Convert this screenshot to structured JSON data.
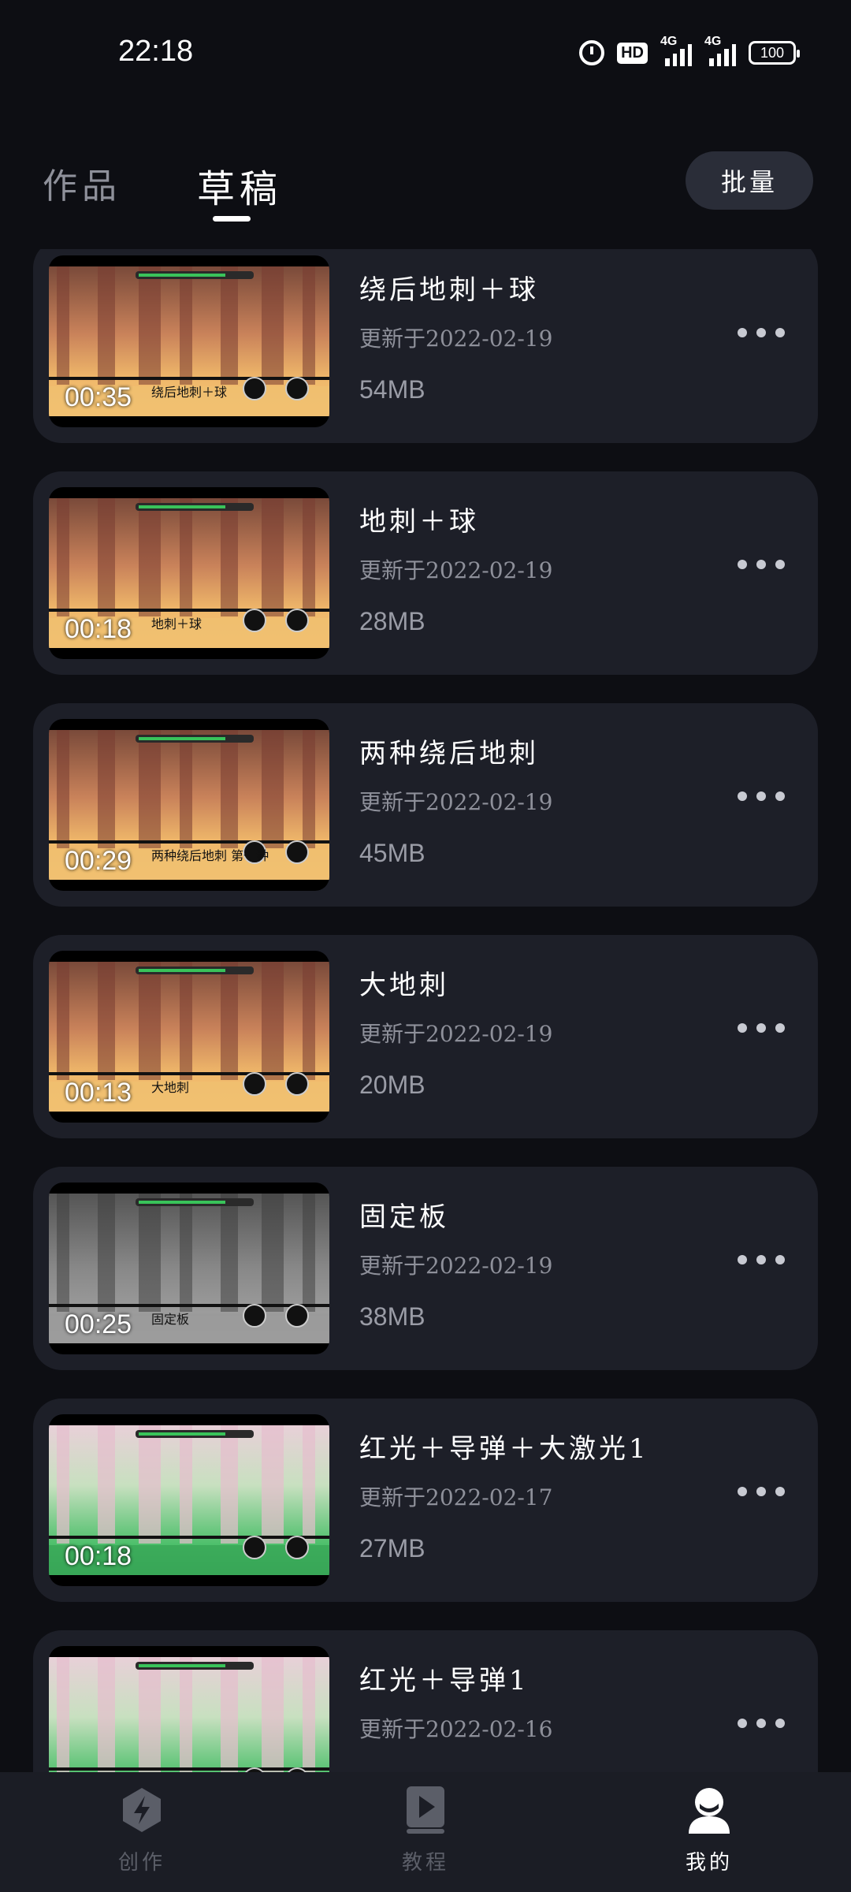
{
  "status_bar": {
    "time": "22:18",
    "hd": "HD",
    "sim1": "4G",
    "sim2": "4G",
    "battery": "100"
  },
  "tabs": {
    "works": "作品",
    "drafts": "草稿",
    "active": "drafts"
  },
  "batch_button": "批量",
  "drafts": [
    {
      "title": "绕后地刺＋球",
      "date": "更新于2022-02-19",
      "size": "54MB",
      "duration": "00:35",
      "caption": "绕后地刺＋球",
      "scene": "desert"
    },
    {
      "title": "地刺＋球",
      "date": "更新于2022-02-19",
      "size": "28MB",
      "duration": "00:18",
      "caption": "地刺＋球",
      "scene": "desert"
    },
    {
      "title": "两种绕后地刺",
      "date": "更新于2022-02-19",
      "size": "45MB",
      "duration": "00:29",
      "caption": "两种绕后地刺 第一种",
      "scene": "desert"
    },
    {
      "title": "大地刺",
      "date": "更新于2022-02-19",
      "size": "20MB",
      "duration": "00:13",
      "caption": "大地刺",
      "scene": "desert"
    },
    {
      "title": "固定板",
      "date": "更新于2022-02-19",
      "size": "38MB",
      "duration": "00:25",
      "caption": "固定板",
      "scene": "gray"
    },
    {
      "title": "红光＋导弹＋大激光1",
      "date": "更新于2022-02-17",
      "size": "27MB",
      "duration": "00:18",
      "caption": "",
      "scene": "forest"
    },
    {
      "title": "红光＋导弹1",
      "date": "更新于2022-02-16",
      "size": "",
      "duration": "",
      "caption": "",
      "scene": "forest"
    }
  ],
  "bottom_nav": [
    {
      "label": "创作",
      "icon": "lightning-icon",
      "active": false
    },
    {
      "label": "教程",
      "icon": "play-book-icon",
      "active": false
    },
    {
      "label": "我的",
      "icon": "user-icon",
      "active": true
    }
  ],
  "colors": {
    "background": "#0d0e13",
    "card": "#1d1f28",
    "muted_text": "#8e909a",
    "nav_inactive": "#5b5e68",
    "nav_active": "#ffffff"
  }
}
